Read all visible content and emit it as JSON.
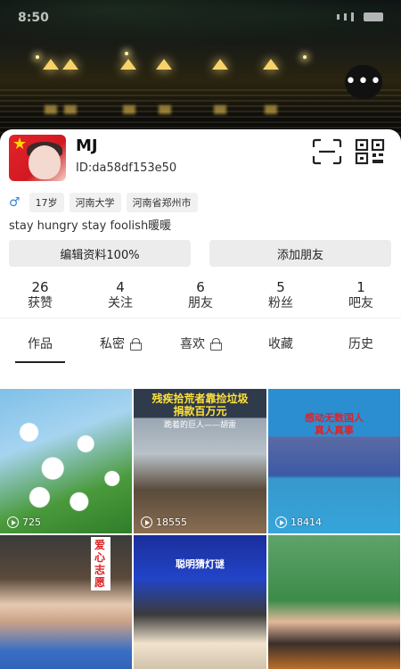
{
  "status_bar": {
    "time": "8:50"
  },
  "profile": {
    "nickname": "MJ",
    "id_text": "ID:da58df153e50",
    "gender_symbol": "♂",
    "tags": [
      "17岁",
      "河南大学",
      "河南省郑州市"
    ],
    "bio": "stay hungry stay foolish暖暖"
  },
  "buttons": {
    "edit_profile": "编辑资料100%",
    "add_friend": "添加朋友"
  },
  "stats": [
    {
      "num": "26",
      "label": "获赞"
    },
    {
      "num": "4",
      "label": "关注"
    },
    {
      "num": "6",
      "label": "朋友"
    },
    {
      "num": "5",
      "label": "粉丝"
    },
    {
      "num": "1",
      "label": "吧友"
    }
  ],
  "tabs": [
    {
      "label": "作品",
      "locked": false,
      "active": true
    },
    {
      "label": "私密",
      "locked": true,
      "active": false
    },
    {
      "label": "喜欢",
      "locked": true,
      "active": false
    },
    {
      "label": "收藏",
      "locked": false,
      "active": false
    },
    {
      "label": "历史",
      "locked": false,
      "active": false
    }
  ],
  "videos": [
    {
      "views": "725",
      "caption_lines": []
    },
    {
      "views": "18555",
      "caption_lines": [
        "残疾拾荒者靠捡垃圾",
        "捐款百万元",
        "跪着的巨人——胡雷"
      ]
    },
    {
      "views": "18414",
      "caption_lines": [
        "感动无数国人",
        "真人真事"
      ]
    },
    {
      "views": "",
      "caption_lines": [
        "爱心志愿"
      ]
    },
    {
      "views": "",
      "caption_lines": [
        "聪明猜灯谜"
      ]
    },
    {
      "views": "",
      "caption_lines": []
    }
  ],
  "icons": {
    "more": "more-dots-icon",
    "scan": "scan-icon",
    "qr": "qr-code-icon",
    "lock": "lock-icon",
    "play": "play-icon",
    "gender": "male-icon"
  }
}
